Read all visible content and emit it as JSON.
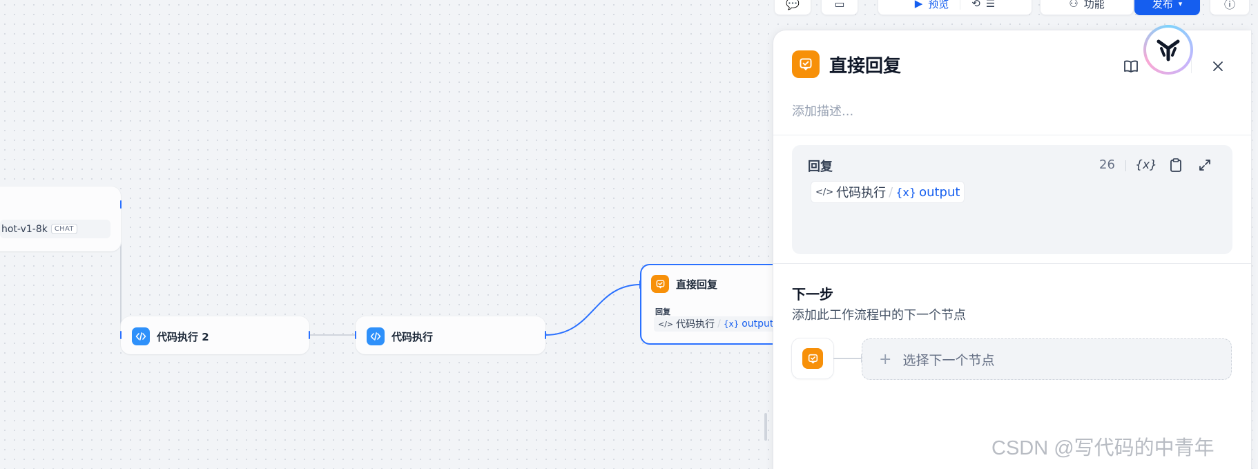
{
  "canvas": {
    "llm_node": {
      "model_name": "hot-v1-8k",
      "model_tag": "CHAT"
    },
    "code_node_2": {
      "title": "代码执行 2"
    },
    "code_node": {
      "title": "代码执行"
    },
    "reply_node": {
      "title": "直接回复",
      "field_label": "回复",
      "var_node": "代码执行",
      "var_sep": "/",
      "var_name": "output"
    }
  },
  "toolbar": {
    "preview_label": "预览",
    "features_label": "功能",
    "publish_label": "发布"
  },
  "panel": {
    "title": "直接回复",
    "description_placeholder": "添加描述...",
    "reply": {
      "label": "回复",
      "count": "26",
      "var_node": "代码执行",
      "var_sep": "/",
      "var_name": "output"
    },
    "next_step": {
      "title": "下一步",
      "subtitle": "添加此工作流程中的下一个节点",
      "select_label": "选择下一个节点"
    }
  },
  "watermark": "CSDN @写代码的中青年",
  "colors": {
    "accent": "#155eef",
    "code": "#2e90fa",
    "reply": "#f79009",
    "edge": "#2970ff"
  }
}
